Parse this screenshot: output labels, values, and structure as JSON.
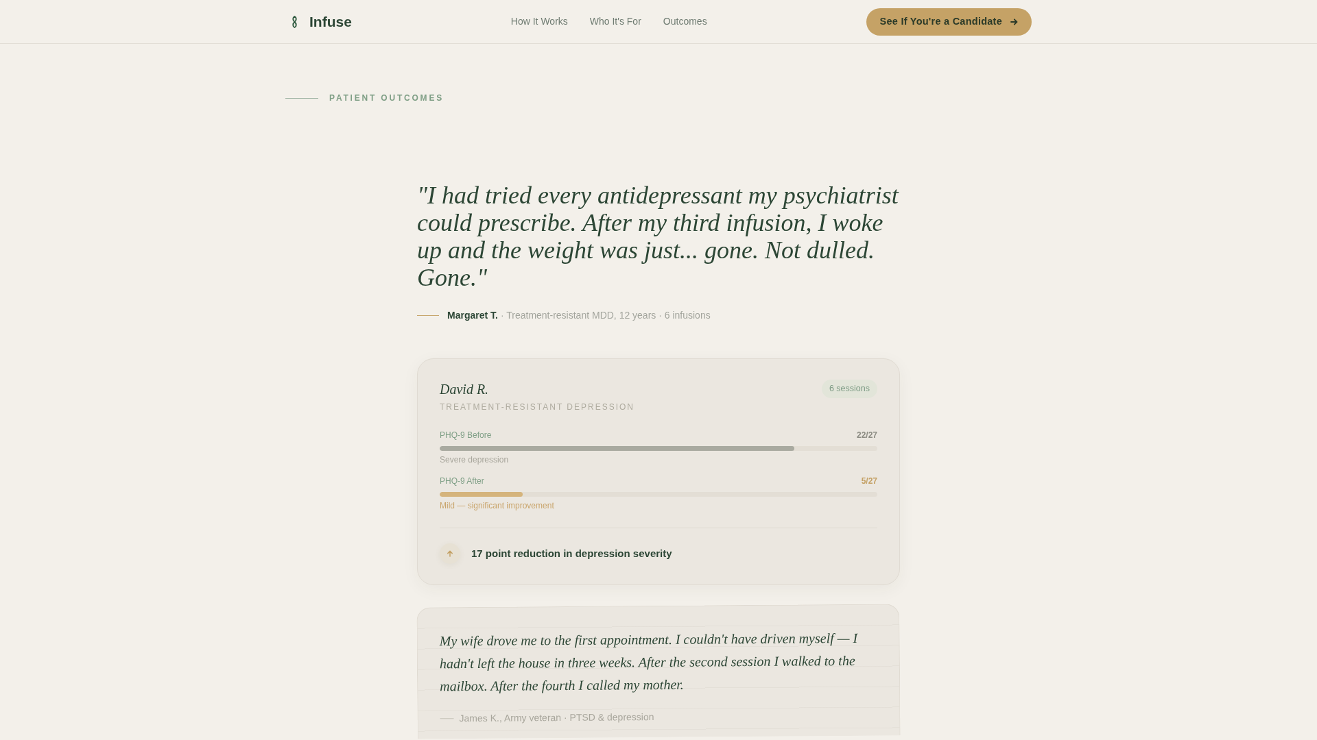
{
  "header": {
    "logo": {
      "text": "Infuse"
    },
    "nav": [
      {
        "label": "How It Works"
      },
      {
        "label": "Who It's For"
      },
      {
        "label": "Outcomes"
      }
    ],
    "cta": {
      "label": "See If You're a Candidate"
    }
  },
  "section_label": "PATIENT OUTCOMES",
  "featured_quote": {
    "text": "\"I had tried every antidepressant my psychiatrist could prescribe. After my third infusion, I woke up and the weight was just... gone. Not dulled. Gone.\"",
    "author": "Margaret T.",
    "details": "· Treatment-resistant MDD, 12 years · 6 infusions"
  },
  "case_card": {
    "name": "David R.",
    "badge": "6 sessions",
    "condition": "TREATMENT-RESISTANT DEPRESSION",
    "scores": [
      {
        "kind": "before",
        "label": "PHQ-9 Before",
        "value": "22/27",
        "level": 0.81,
        "note": "Severe depression"
      },
      {
        "kind": "after",
        "label": "PHQ-9 After",
        "value": "5/27",
        "level": 0.19,
        "note": "Mild — significant improvement"
      }
    ],
    "summary": "17 point reduction in depression severity"
  },
  "testimonial_card": {
    "text": "My wife drove me to the first appointment. I couldn't have driven myself — I hadn't left the house in three weeks. After the second session I walked to the mailbox. After the fourth I called my mother.",
    "attribution": "James K., Army veteran · PTSD & depression"
  }
}
